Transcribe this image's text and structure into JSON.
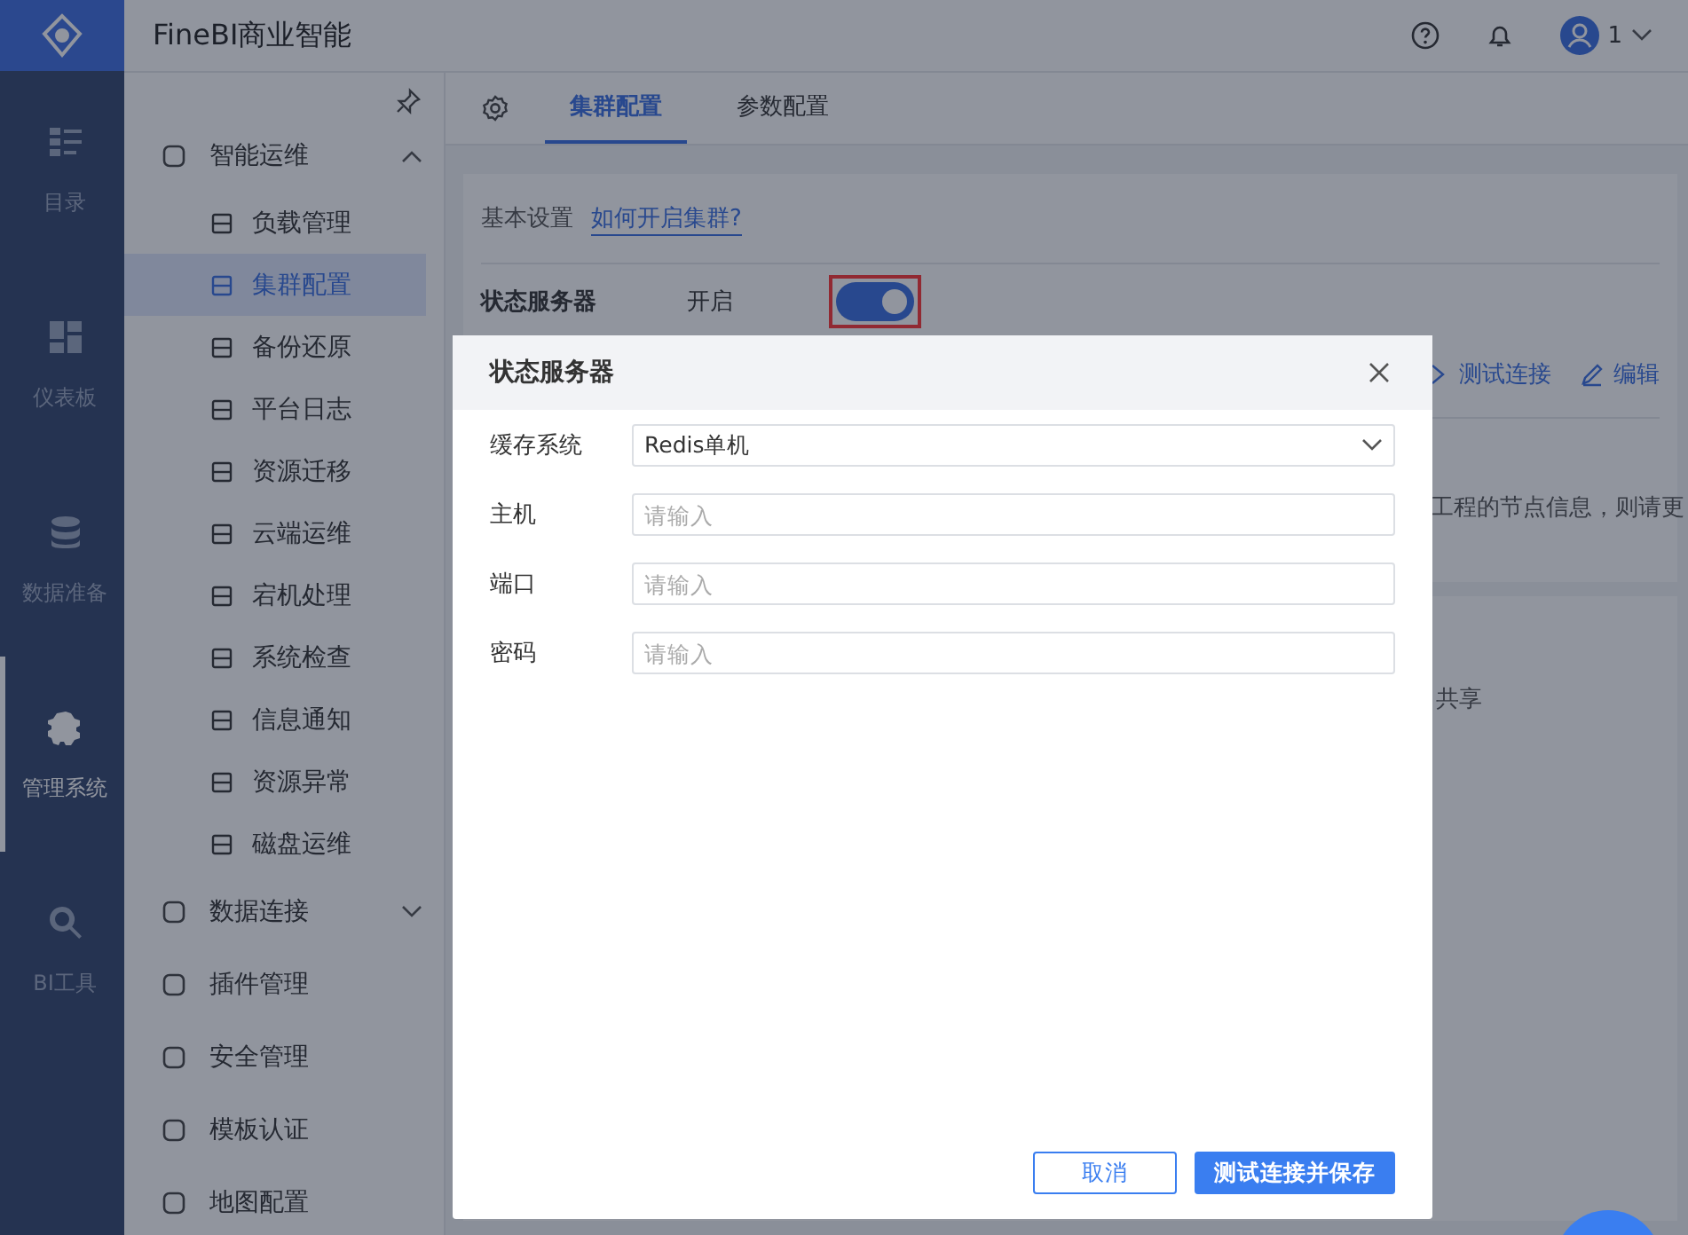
{
  "app": {
    "title": "FineBI商业智能",
    "user": "1"
  },
  "rail": [
    {
      "label": "目录",
      "selected": false
    },
    {
      "label": "仪表板",
      "selected": false
    },
    {
      "label": "数据准备",
      "selected": false
    },
    {
      "label": "管理系统",
      "selected": true
    },
    {
      "label": "BI工具",
      "selected": false
    }
  ],
  "sidebar": {
    "items": [
      {
        "label": "智能运维",
        "expanded": true,
        "children": [
          {
            "label": "负载管理",
            "selected": false
          },
          {
            "label": "集群配置",
            "selected": true
          },
          {
            "label": "备份还原",
            "selected": false
          },
          {
            "label": "平台日志",
            "selected": false
          },
          {
            "label": "资源迁移",
            "selected": false
          },
          {
            "label": "云端运维",
            "selected": false
          },
          {
            "label": "宕机处理",
            "selected": false
          },
          {
            "label": "系统检查",
            "selected": false
          },
          {
            "label": "信息通知",
            "selected": false
          },
          {
            "label": "资源异常",
            "selected": false
          },
          {
            "label": "磁盘运维",
            "selected": false
          }
        ]
      },
      {
        "label": "数据连接",
        "expanded": false
      },
      {
        "label": "插件管理"
      },
      {
        "label": "安全管理"
      },
      {
        "label": "模板认证"
      },
      {
        "label": "地图配置"
      }
    ]
  },
  "tabs": [
    {
      "label": "集群配置",
      "selected": true
    },
    {
      "label": "参数配置",
      "selected": false
    }
  ],
  "settings": {
    "section": "基本设置",
    "help_link": "如何开启集群?",
    "state_server": {
      "label": "状态服务器",
      "status": "开启",
      "on": true,
      "highlighted": true
    },
    "actions": [
      "测试连接",
      "编辑"
    ],
    "note": "工程的节点信息，则请更",
    "share": "共享"
  },
  "dialog": {
    "title": "状态服务器",
    "fields": [
      {
        "kind": "select",
        "label": "缓存系统",
        "value": "Redis单机"
      },
      {
        "kind": "input",
        "label": "主机",
        "placeholder": "请输入"
      },
      {
        "kind": "input",
        "label": "端口",
        "placeholder": "请输入"
      },
      {
        "kind": "input",
        "label": "密码",
        "placeholder": "请输入"
      }
    ],
    "buttons": [
      {
        "kind": "secondary",
        "label": "取消"
      },
      {
        "kind": "primary",
        "label": "测试连接并保存"
      }
    ]
  }
}
